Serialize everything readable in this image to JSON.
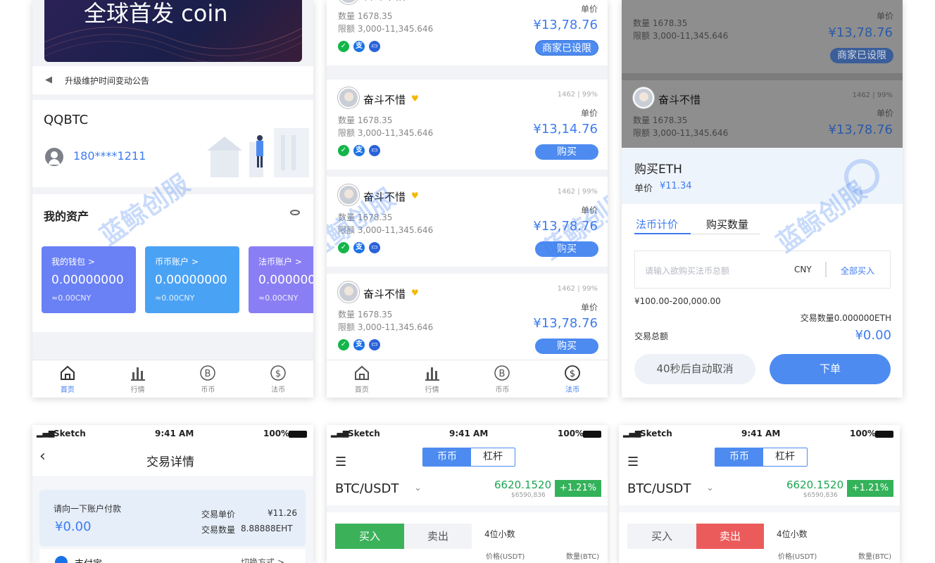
{
  "watermark": "蓝鲸创服",
  "home": {
    "banner_text": "全球首发 coin",
    "notice": "升级维护时间变动公告",
    "app_name": "QQBTC",
    "phone": "180****1211",
    "assets_title": "我的资产",
    "accounts": [
      {
        "label": "我的钱包 >",
        "amount": "0.00000000",
        "cny": "≈0.00CNY",
        "color": "#6a80f5"
      },
      {
        "label": "币币账户 >",
        "amount": "0.00000000",
        "cny": "≈0.00CNY",
        "color": "#4aa2f5"
      },
      {
        "label": "法币账户 >",
        "amount": "0.000000",
        "cny": "≈0.00CNY",
        "color": "#8a7ef4"
      }
    ]
  },
  "tabs": [
    "首页",
    "行情",
    "币币",
    "法币"
  ],
  "otc": {
    "listings": [
      {
        "name": "奋斗不惜",
        "stats": "1462 | 99%",
        "qty": "数量  1678.35",
        "limit": "限额  3,000-11,345.646",
        "price_label": "单价",
        "price": "¥13,78.76",
        "button": "商家已设限"
      },
      {
        "name": "奋斗不惜",
        "stats": "1462 | 99%",
        "qty": "数量  1678.35",
        "limit": "限额  3,000-11,345.646",
        "price_label": "单价",
        "price": "¥13,14.76",
        "button": "购买"
      },
      {
        "name": "奋斗不惜",
        "stats": "1462 | 99%",
        "qty": "数量  1678.35",
        "limit": "限额  3,000-11,345.646",
        "price_label": "单价",
        "price": "¥13,78.76",
        "button": "购买"
      },
      {
        "name": "奋斗不惜",
        "stats": "1462 | 99%",
        "qty": "数量  1678.35",
        "limit": "限额  3,000-11,345.646",
        "price_label": "单价",
        "price": "¥13,78.76",
        "button": "购买"
      }
    ]
  },
  "buy_sheet": {
    "title": "购买ETH",
    "unit_label": "单价",
    "unit_price": "¥11.34",
    "tab_fiat": "法币计价",
    "tab_qty": "购买数量",
    "placeholder": "请输入欲购买法币总额",
    "currency": "CNY",
    "buy_all": "全部买入",
    "range": "¥100.00-200,000.00",
    "trade_qty": "交易数量0.000000ETH",
    "total_label": "交易总额",
    "total": "¥0.00",
    "cancel": "40秒后自动取消",
    "order": "下单"
  },
  "status_bar": {
    "carrier": "Sketch",
    "time": "9:41 AM",
    "battery": "100%"
  },
  "detail": {
    "title": "交易详情",
    "pay_prompt": "请向一下账户付款",
    "amount": "¥0.00",
    "unit_label": "交易单价",
    "unit_value": "¥11.26",
    "qty_label": "交易数量",
    "qty_value": "8.88888EHT",
    "pay_method": "支付宝",
    "switch": "切换方式 >"
  },
  "trade": {
    "mode_coin": "币币",
    "mode_lever": "杠杆",
    "pair": "BTC/USDT",
    "price": "6620.1520",
    "price_sub": "$6590,836",
    "change": "+1.21%",
    "buy": "买入",
    "sell": "卖出",
    "decimals": "4位小数",
    "col_price": "价格(USDT)",
    "col_qty": "数量(BTC)"
  }
}
